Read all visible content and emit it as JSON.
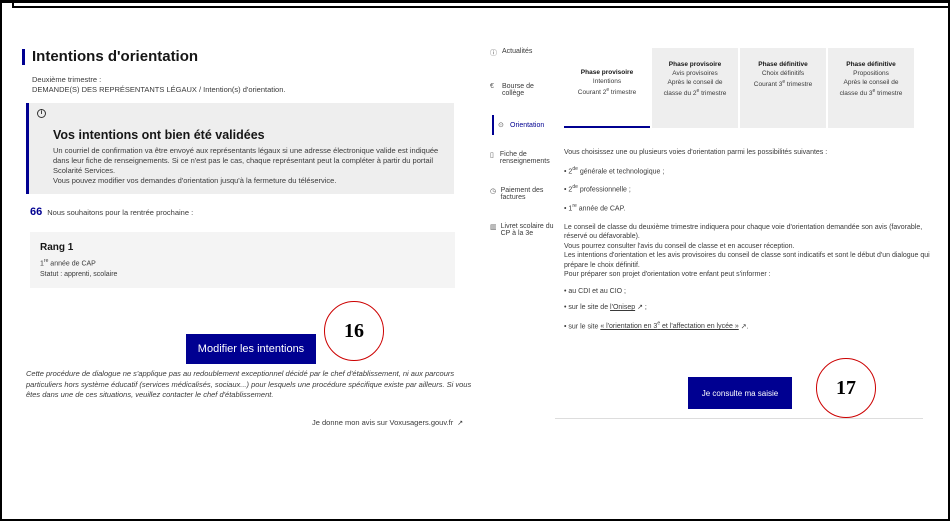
{
  "page_title": "Intentions d'orientation",
  "meta": {
    "line1": "Deuxième trimestre :",
    "line2": "DEMANDE(S) DES REPRÉSENTANTS LÉGAUX / Intention(s) d'orientation."
  },
  "alert": {
    "info_symbol": "i",
    "heading": "Vos intentions ont bien été validées",
    "p1": "Un courriel de confirmation va être envoyé aux représentants légaux si une adresse électronique valide est indiquée dans leur fiche de renseignements. Si ce n'est pas le cas, chaque représentant peut la compléter à partir du portail Scolarité Services.",
    "p2": "Vous pouvez modifier vos demandes d'orientation jusqu'à la fermeture du téléservice."
  },
  "quote": {
    "mark": "66",
    "text": "Nous souhaitons pour la rentrée prochaine :"
  },
  "rank": {
    "title": "Rang 1",
    "choice_sup": "re",
    "choice_rest": " année de CAP",
    "choice_num": "1",
    "status": "Statut : apprenti, scolaire"
  },
  "modify_button": "Modifier les intentions",
  "notice": "Cette procédure de dialogue ne s'applique pas au redoublement exceptionnel décidé par le chef d'établissement, ni aux parcours particuliers hors système éducatif (services médicalisés, sociaux...) pour lesquels une procédure spécifique existe par ailleurs. Si vous êtes dans une de ces situations, veuillez contacter le chef d'établissement.",
  "vox_link": "Je donne mon avis sur Voxusagers.gouv.fr",
  "badges": {
    "b16": "16",
    "b17": "17"
  },
  "nav": [
    {
      "label": "Actualités",
      "icon": "info-icon"
    },
    {
      "label": "Bourse de collège",
      "icon": "euro-icon"
    },
    {
      "label": "Orientation",
      "icon": "compass-icon"
    },
    {
      "label": "Fiche de renseignements",
      "icon": "file-icon"
    },
    {
      "label": "Paiement des factures",
      "icon": "money-icon"
    },
    {
      "label": "Livret scolaire du CP à la 3e",
      "icon": "book-icon"
    }
  ],
  "tabs": [
    {
      "title": "Phase provisoire",
      "sub1": "Intentions",
      "sub2": "Courant 2",
      "sup": "e",
      "sub3": " trimestre"
    },
    {
      "title": "Phase provisoire",
      "sub1": "Avis provisoires",
      "sub2": "Après le conseil de",
      "sub3a": "classe du 2",
      "sup": "e",
      "sub3": " trimestre"
    },
    {
      "title": "Phase définitive",
      "sub1": "Choix définitifs",
      "sub2": "Courant 3",
      "sup": "e",
      "sub3": " trimestre"
    },
    {
      "title": "Phase définitive",
      "sub1": "Propositions",
      "sub2": "Après le conseil de",
      "sub3a": "classe du 3",
      "sup": "e",
      "sub3": " trimestre"
    }
  ],
  "right_text": {
    "intro": "Vous choisissez une ou plusieurs voies d'orientation parmi les possibilités suivantes :",
    "opt1_n": "2",
    "opt1_sup": "de",
    "opt1": " générale et technologique ;",
    "opt2_n": "2",
    "opt2_sup": "de",
    "opt2": " professionnelle ;",
    "opt3_n": "1",
    "opt3_sup": "re",
    "opt3": " année de CAP.",
    "para1": "Le conseil de classe du deuxième trimestre indiquera pour chaque voie d'orientation demandée son avis (favorable, réservé ou défavorable).",
    "para2": "Vous pourrez consulter l'avis du conseil de classe et en accuser réception.",
    "para3": "Les intentions d'orientation et les avis provisoires du conseil de classe sont indicatifs et sont le début d'un dialogue qui prépare le choix définitif.",
    "para4": "Pour préparer son projet d'orientation votre enfant peut s'informer :",
    "b1": "au CDI et au CIO ;",
    "b2a": "sur le site de ",
    "b2link": "l'Onisep",
    "b2b": " ;",
    "b3a": "sur le site ",
    "b3link1": "« l'orientation en 3",
    "b3sup": "e",
    "b3link2": " et l'affectation en lycée »",
    "b3b": "."
  },
  "consult_button": "Je consulte ma saisie",
  "colors": {
    "accent": "#000091",
    "badge_border": "#cc0000"
  }
}
